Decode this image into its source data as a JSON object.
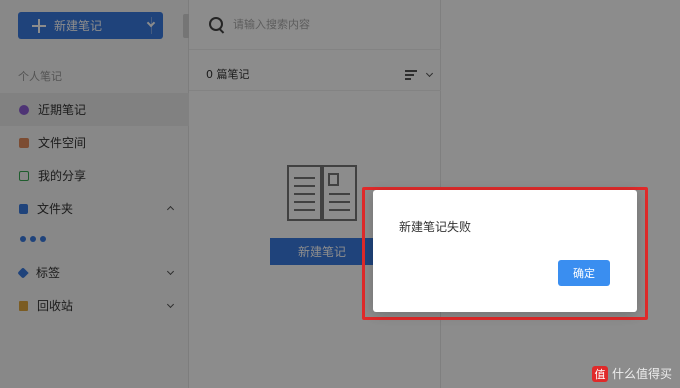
{
  "sidebar": {
    "new_note_label": "新建笔记",
    "section_title": "个人笔记",
    "items": [
      {
        "label": "近期笔记",
        "icon": "clock-icon"
      },
      {
        "label": "文件空间",
        "icon": "folder-space-icon"
      },
      {
        "label": "我的分享",
        "icon": "share-icon"
      },
      {
        "label": "文件夹",
        "icon": "folder-icon"
      },
      {
        "label": "标签",
        "icon": "tag-icon"
      },
      {
        "label": "回收站",
        "icon": "trash-icon"
      }
    ]
  },
  "list": {
    "search_placeholder": "请输入搜索内容",
    "count_label": "0 篇笔记",
    "empty_new_label": "新建笔记"
  },
  "dialog": {
    "message": "新建笔记失败",
    "ok_label": "确定"
  },
  "watermark": {
    "badge": "值",
    "text": "什么值得买"
  },
  "colors": {
    "accent": "#3a7ae0",
    "highlight": "#e02a2a"
  }
}
